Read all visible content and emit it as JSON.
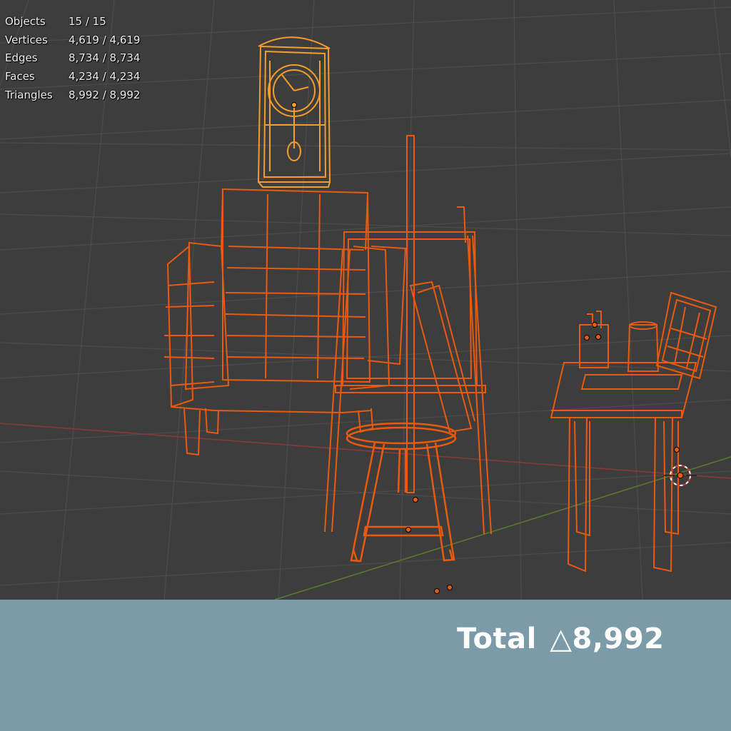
{
  "stats": [
    {
      "label": "Objects",
      "value": "15 / 15"
    },
    {
      "label": "Vertices",
      "value": "4,619 / 4,619"
    },
    {
      "label": "Edges",
      "value": "8,734 / 8,734"
    },
    {
      "label": "Faces",
      "value": "4,234 / 4,234"
    },
    {
      "label": "Triangles",
      "value": "8,992 / 8,992"
    }
  ],
  "total": {
    "label": "Total",
    "symbol": "△",
    "value": "8,992"
  },
  "colors": {
    "viewport_bg": "#3d3d3d",
    "grid": "#4a4a4a",
    "x_axis": "#8a3a3a",
    "y_axis": "#5a7a2a",
    "selected_wire": "#e85a10",
    "active_wire": "#f29d2c",
    "footer_bg": "#7a9ba7"
  }
}
